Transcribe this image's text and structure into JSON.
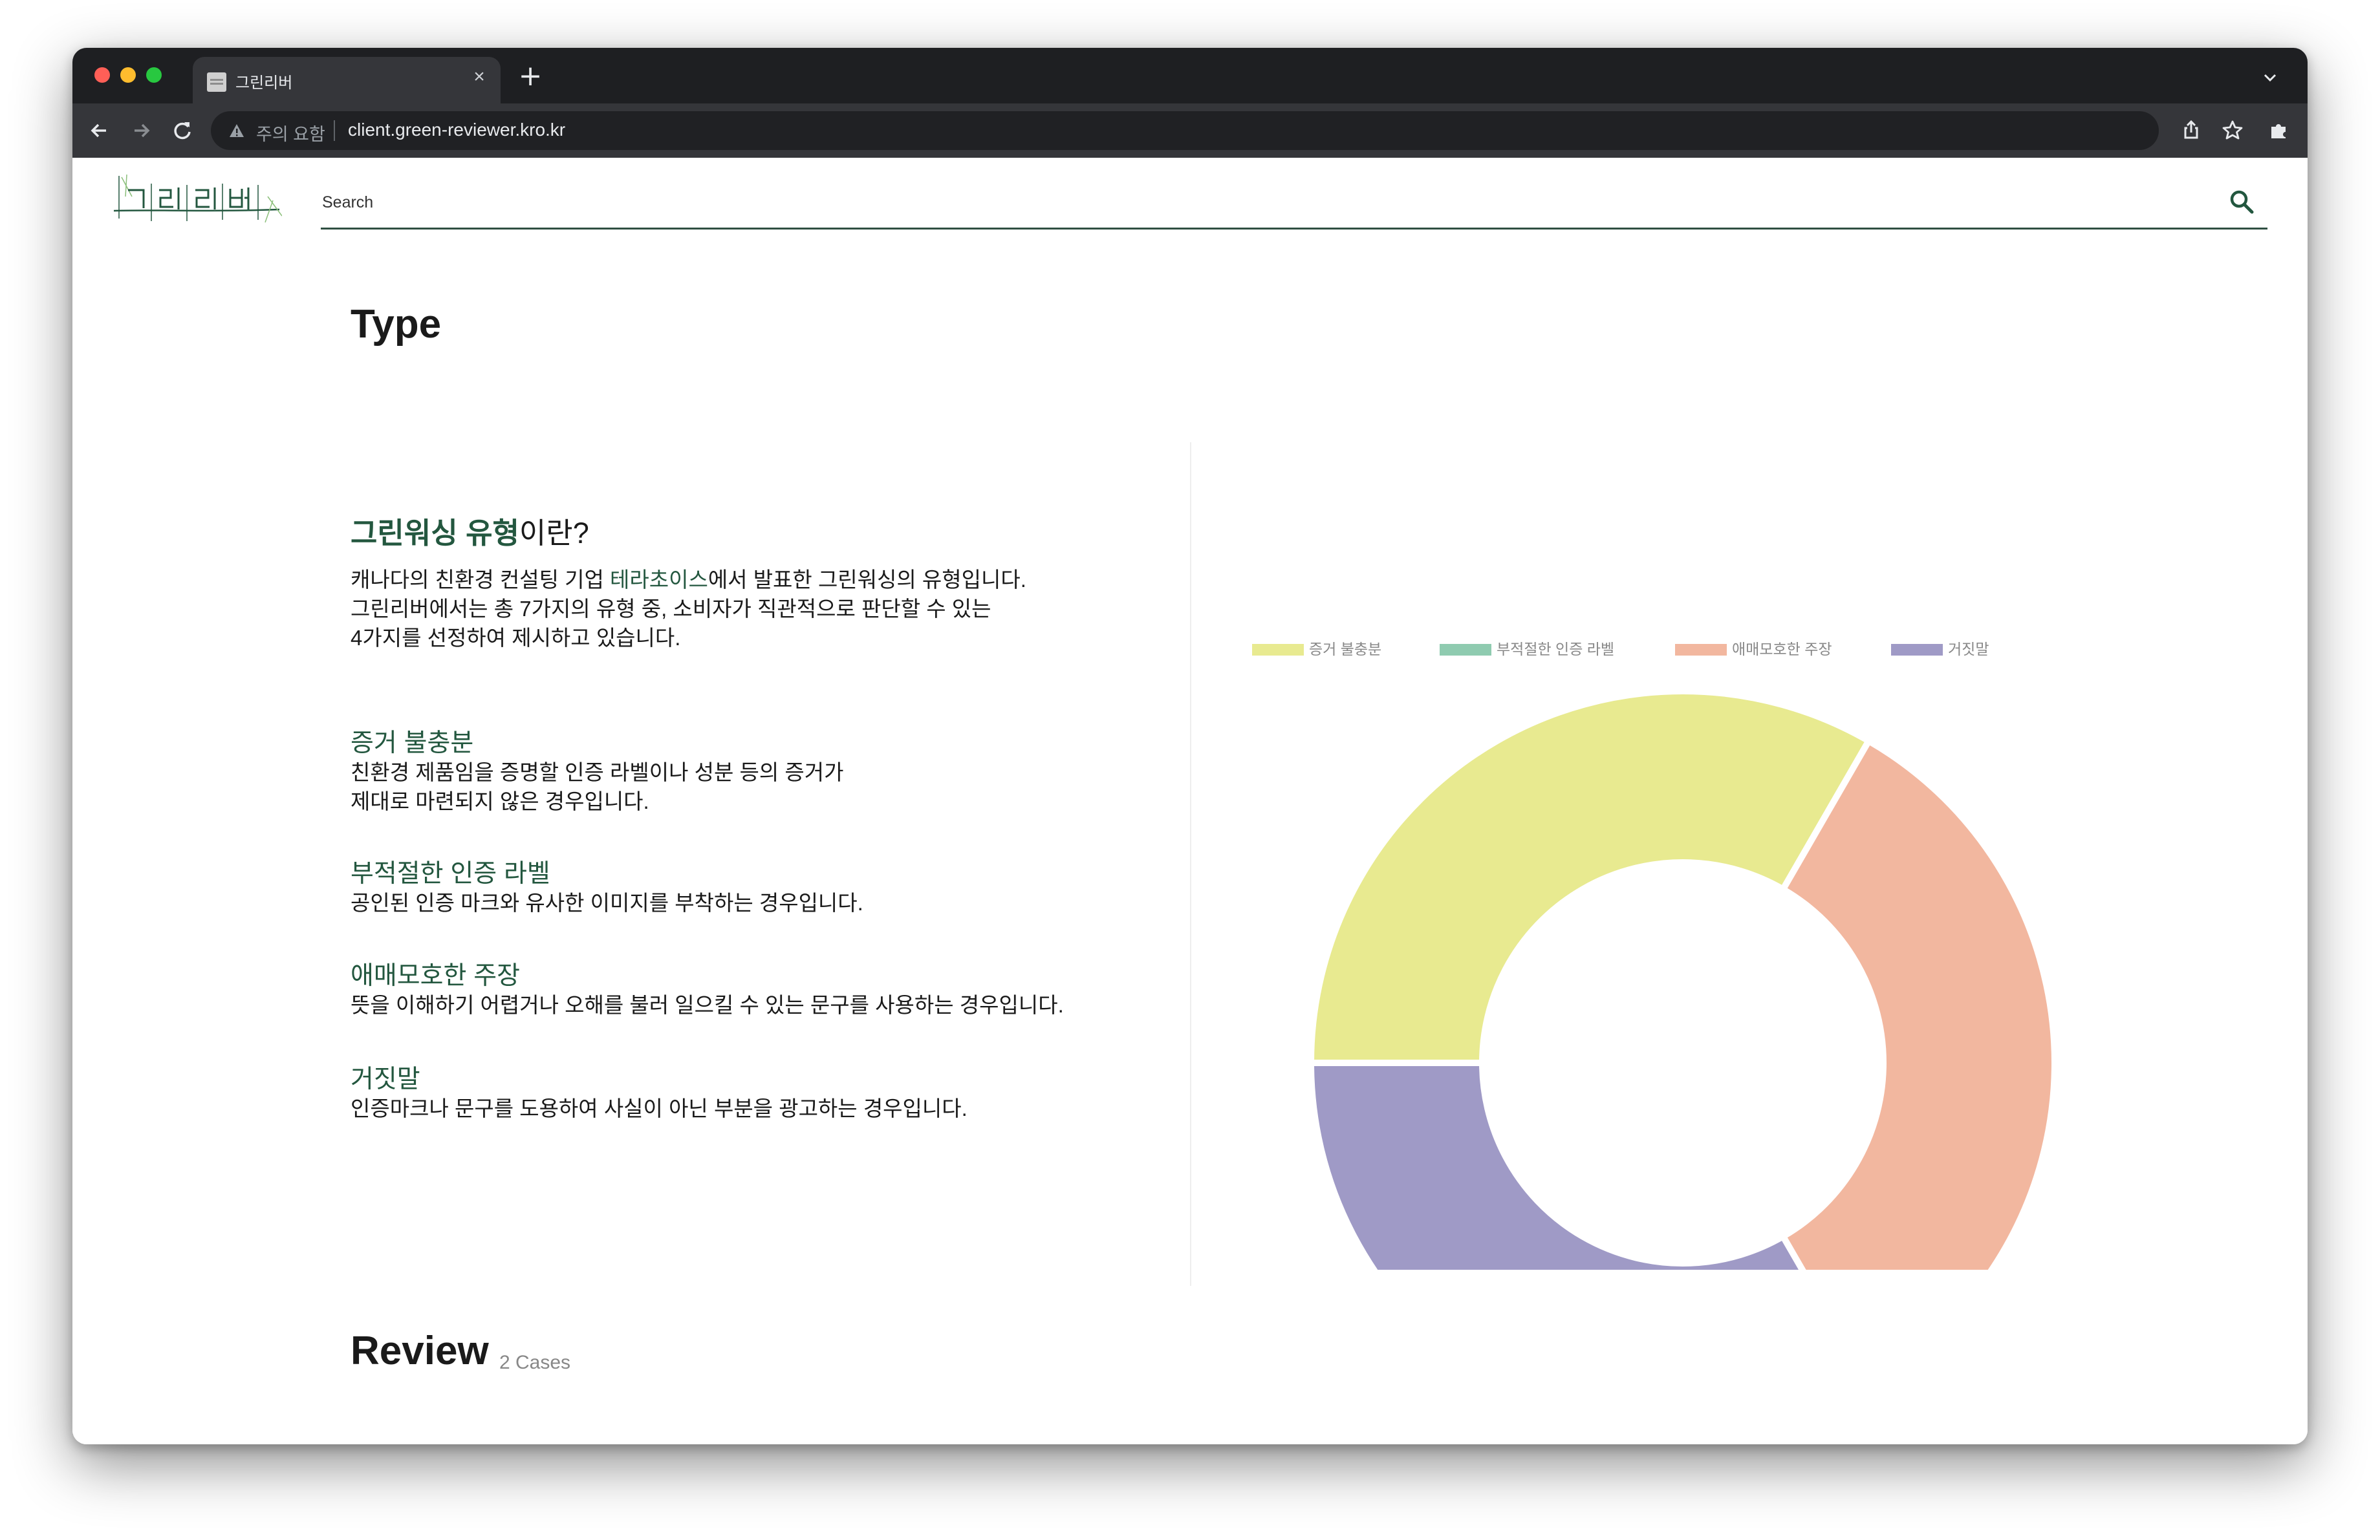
{
  "browser": {
    "tab_title": "그린리버",
    "security_label": "주의 요함",
    "url": "client.green-reviewer.kro.kr"
  },
  "header": {
    "logo_text": "그린리버",
    "search_placeholder": "Search"
  },
  "main": {
    "section_title": "Type",
    "intro": {
      "title_highlight": "그린워싱 유형",
      "title_rest": "이란?",
      "line1_pre": "캐나다의 친환경 컨설팅 기업 ",
      "line1_accent": "테라초이스",
      "line1_post": "에서 발표한 그린워싱의 유형입니다.",
      "line2": "그린리버에서는 총 7가지의 유형 중, 소비자가 직관적으로 판단할 수 있는",
      "line3": "4가지를 선정하여 제시하고 있습니다."
    },
    "types": [
      {
        "name": "증거 불충분",
        "desc_lines": [
          "친환경 제품임을 증명할 인증 라벨이나 성분 등의 증거가",
          "제대로 마련되지 않은 경우입니다."
        ]
      },
      {
        "name": "부적절한 인증 라벨",
        "desc_lines": [
          "공인된 인증 마크와 유사한 이미지를 부착하는 경우입니다."
        ]
      },
      {
        "name": "애매모호한 주장",
        "desc_lines": [
          "뜻을 이해하기 어렵거나 오해를 불러 일으킬 수 있는 문구를 사용하는 경우입니다."
        ]
      },
      {
        "name": "거짓말",
        "desc_lines": [
          "인증마크나 문구를 도용하여 사실이 아닌 부분을 광고하는 경우입니다."
        ]
      }
    ],
    "review_title": "Review",
    "review_count": "2 Cases"
  },
  "chart_data": {
    "type": "pie",
    "variant": "doughnut",
    "legend_position": "top",
    "categories": [
      "증거 불충분",
      "부적절한 인증 라벨",
      "애매모호한 주장",
      "거짓말"
    ],
    "values": [
      1,
      0,
      1,
      1
    ],
    "colors": [
      "#e8ea90",
      "#8fcbb0",
      "#f2b79f",
      "#9f9ac6"
    ]
  }
}
